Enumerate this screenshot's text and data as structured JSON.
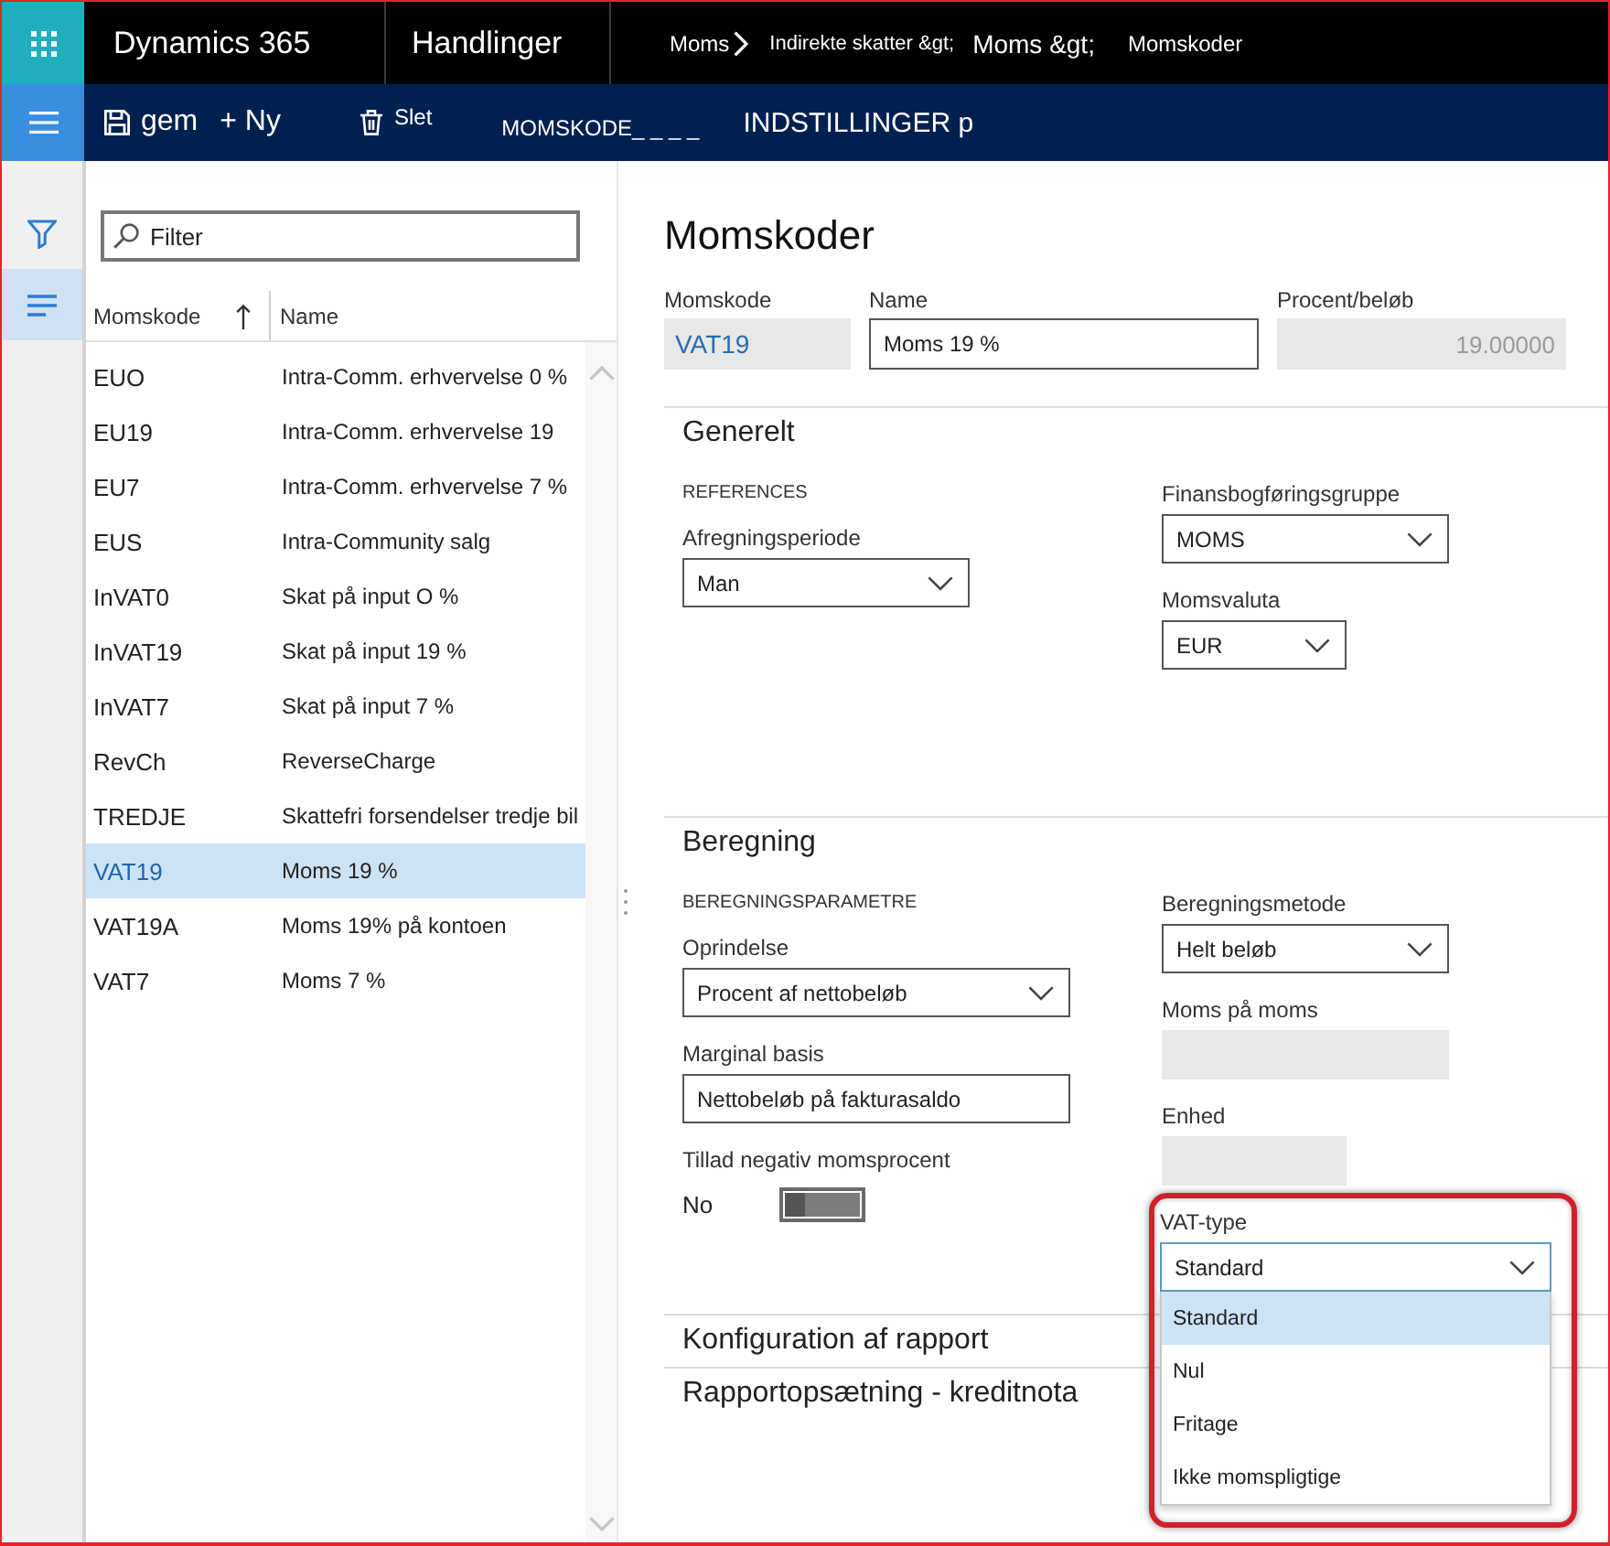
{
  "app_bar": {
    "title": "Dynamics 365",
    "module": "Handlinger",
    "breadcrumb": [
      {
        "label": "Moms",
        "kind": "small",
        "chevron": true
      },
      {
        "label": "Indirekte skatter &gt;",
        "kind": "tiny",
        "chevron": false
      },
      {
        "label": "Moms &gt;",
        "kind": "large",
        "chevron": false
      },
      {
        "label": "Momskoder",
        "kind": "small",
        "chevron": false
      }
    ]
  },
  "action_bar": {
    "buttons": [
      {
        "kind": "save",
        "label": "gem"
      },
      {
        "kind": "new",
        "label": "+ Ny"
      },
      {
        "kind": "delete",
        "label": "Slet"
      }
    ],
    "tabs": [
      {
        "label": "MOMSKODE_ _ _ _"
      },
      {
        "label": "INDSTILLINGER p"
      }
    ]
  },
  "nav_rail": [
    {
      "kind": "filter",
      "selected": false
    },
    {
      "kind": "list",
      "selected": true
    }
  ],
  "list": {
    "filter": {
      "placeholder": "Filter"
    },
    "columns": [
      {
        "label": "Momskode",
        "sorted": true
      },
      {
        "label": "Name",
        "sorted": false
      }
    ],
    "rows": [
      {
        "code": "EUO",
        "name": "Intra-Comm. erhvervelse 0 %",
        "selected": false
      },
      {
        "code": "EU19",
        "name": "Intra-Comm. erhvervelse 19",
        "selected": false
      },
      {
        "code": "EU7",
        "name": "Intra-Comm. erhvervelse 7 %",
        "selected": false
      },
      {
        "code": "EUS",
        "name": "Intra-Community salg",
        "selected": false
      },
      {
        "code": "InVAT0",
        "name": "Skat på input O %",
        "selected": false
      },
      {
        "code": "InVAT19",
        "name": "Skat på input 19 %",
        "selected": false
      },
      {
        "code": "InVAT7",
        "name": "Skat på input 7 %",
        "selected": false
      },
      {
        "code": "RevCh",
        "name": "ReverseCharge",
        "selected": false
      },
      {
        "code": "TREDJE",
        "name": "Skattefri forsendelser tredje bil",
        "selected": false
      },
      {
        "code": "VAT19",
        "name": "Moms 19 %",
        "selected": true
      },
      {
        "code": "VAT19A",
        "name": "Moms 19% på kontoen",
        "selected": false
      },
      {
        "code": "VAT7",
        "name": "Moms 7 %",
        "selected": false
      }
    ]
  },
  "form": {
    "title": "Momskoder",
    "header_fields": [
      {
        "label": "Momskode",
        "kind": "link",
        "value": "VAT19"
      },
      {
        "label": "Name",
        "kind": "input",
        "value": "Moms 19 %"
      },
      {
        "label": "Procent/beløb",
        "kind": "readonly",
        "value": "19.00000"
      }
    ],
    "sections": [
      {
        "title": "Generelt",
        "groups": [
          {
            "heading": "REFERENCES",
            "fields": [
              {
                "label": "Afregningsperiode",
                "kind": "select",
                "value": "Man",
                "highlighted": false
              }
            ]
          },
          {
            "fields": [
              {
                "label": "Finansbogføringsgruppe",
                "kind": "select",
                "value": "MOMS",
                "highlighted": false
              },
              {
                "label": "Momsvaluta",
                "kind": "select",
                "value": "EUR",
                "highlighted": false
              }
            ]
          }
        ]
      },
      {
        "title": "Beregning",
        "groups": [
          {
            "heading": "BEREGNINGSPARAMETRE",
            "fields": [
              {
                "label": "Oprindelse",
                "kind": "select",
                "value": "Procent af nettobeløb",
                "highlighted": false
              },
              {
                "label": "Marginal basis",
                "kind": "input",
                "value": "Nettobeløb på fakturasaldo",
                "highlighted": false
              },
              {
                "label": "Tillad negativ momsprocent",
                "kind": "toggle",
                "value": "No",
                "on": false,
                "highlighted": false
              }
            ]
          },
          {
            "fields": [
              {
                "label": "Beregningsmetode",
                "kind": "select",
                "value": "Helt beløb",
                "highlighted": false
              },
              {
                "label": "Moms på moms",
                "kind": "readonly",
                "highlighted": false
              },
              {
                "label": "Enhed",
                "kind": "readonly",
                "highlighted": false
              },
              {
                "label": "VAT-type",
                "kind": "select",
                "value": "Standard",
                "highlighted": true,
                "options": [
                  {
                    "label": "Standard",
                    "selected": true
                  },
                  {
                    "label": "Nul",
                    "selected": false
                  },
                  {
                    "label": "Fritage",
                    "selected": false
                  },
                  {
                    "label": "Ikke momspligtige",
                    "selected": false
                  }
                ]
              }
            ]
          }
        ]
      },
      {
        "title": "Konfiguration af rapport"
      },
      {
        "title": "Rapportopsætning - kreditnota"
      }
    ]
  }
}
